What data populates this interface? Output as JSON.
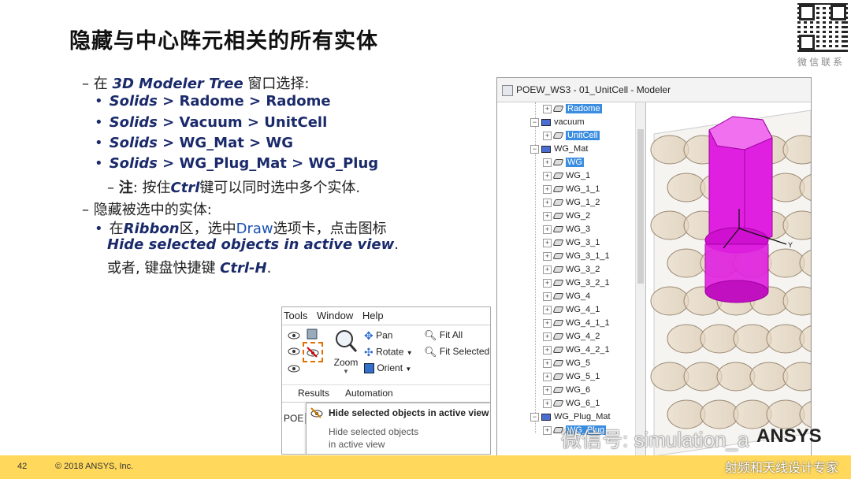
{
  "slide": {
    "title": "隐藏与中心阵元相关的所有实体",
    "page_number": "42",
    "copyright": "© 2018 ANSYS, Inc.",
    "qr_caption": "微信联系",
    "watermark": "微信号: simulation_a",
    "watermark_sub": "射频和天线设计专家",
    "logo_text": "ANSYS",
    "accent_color": "#ffd85c"
  },
  "bullets": {
    "b1_prefix": "– 在 ",
    "b1_em": "3D Modeler Tree",
    "b1_suffix": " 窗口选择:",
    "items": [
      {
        "em": "Solids",
        "rest": " > Radome > Radome"
      },
      {
        "em": "Solids",
        "rest": " > Vacuum > UnitCell"
      },
      {
        "em": "Solids",
        "rest": " > WG_Mat > WG"
      },
      {
        "em": "Solids",
        "rest": " > WG_Plug_Mat > WG_Plug"
      }
    ],
    "note_prefix": "– ",
    "note_label": "注",
    "note_mid": ": 按住",
    "note_key": "Ctrl",
    "note_suffix": "键可以同时选中多个实体.",
    "b2": "– 隐藏被选中的实体:",
    "b2a_prefix": "在",
    "b2a_em": "Ribbon",
    "b2a_mid": "区，选中",
    "b2a_tab": "Draw",
    "b2a_suffix": "选项卡，点击图标",
    "b2a_cmd": "Hide selected objects in active view",
    "b2a_dot": ".",
    "b2b_prefix": "或者, 键盘快捷键 ",
    "b2b_key": "Ctrl-H",
    "b2b_dot": "."
  },
  "modeler": {
    "title": "POEW_WS3 - 01_UnitCell - Modeler",
    "tree": [
      {
        "label": "Radome",
        "kind": "obj",
        "indent": 2,
        "selected": true
      },
      {
        "label": "vacuum",
        "kind": "folder",
        "indent": 1,
        "selected": false
      },
      {
        "label": "UnitCell",
        "kind": "obj",
        "indent": 2,
        "selected": true
      },
      {
        "label": "WG_Mat",
        "kind": "folder",
        "indent": 1,
        "selected": false
      },
      {
        "label": "WG",
        "kind": "obj",
        "indent": 2,
        "selected": true
      },
      {
        "label": "WG_1",
        "kind": "obj",
        "indent": 2,
        "selected": false
      },
      {
        "label": "WG_1_1",
        "kind": "obj",
        "indent": 2,
        "selected": false
      },
      {
        "label": "WG_1_2",
        "kind": "obj",
        "indent": 2,
        "selected": false
      },
      {
        "label": "WG_2",
        "kind": "obj",
        "indent": 2,
        "selected": false
      },
      {
        "label": "WG_3",
        "kind": "obj",
        "indent": 2,
        "selected": false
      },
      {
        "label": "WG_3_1",
        "kind": "obj",
        "indent": 2,
        "selected": false
      },
      {
        "label": "WG_3_1_1",
        "kind": "obj",
        "indent": 2,
        "selected": false
      },
      {
        "label": "WG_3_2",
        "kind": "obj",
        "indent": 2,
        "selected": false
      },
      {
        "label": "WG_3_2_1",
        "kind": "obj",
        "indent": 2,
        "selected": false
      },
      {
        "label": "WG_4",
        "kind": "obj",
        "indent": 2,
        "selected": false
      },
      {
        "label": "WG_4_1",
        "kind": "obj",
        "indent": 2,
        "selected": false
      },
      {
        "label": "WG_4_1_1",
        "kind": "obj",
        "indent": 2,
        "selected": false
      },
      {
        "label": "WG_4_2",
        "kind": "obj",
        "indent": 2,
        "selected": false
      },
      {
        "label": "WG_4_2_1",
        "kind": "obj",
        "indent": 2,
        "selected": false
      },
      {
        "label": "WG_5",
        "kind": "obj",
        "indent": 2,
        "selected": false
      },
      {
        "label": "WG_5_1",
        "kind": "obj",
        "indent": 2,
        "selected": false
      },
      {
        "label": "WG_6",
        "kind": "obj",
        "indent": 2,
        "selected": false
      },
      {
        "label": "WG_6_1",
        "kind": "obj",
        "indent": 2,
        "selected": false
      },
      {
        "label": "WG_Plug_Mat",
        "kind": "folder",
        "indent": 1,
        "selected": false
      },
      {
        "label": "WG_Plug",
        "kind": "obj",
        "indent": 2,
        "selected": true
      }
    ],
    "axis_label_y": "Y",
    "object_color": "#e020e0"
  },
  "ribbon": {
    "menu": [
      "Tools",
      "Window",
      "Help"
    ],
    "zoom_label": "Zoom",
    "pan_label": "Pan",
    "rotate_label": "Rotate",
    "orient_label": "Orient",
    "fit_all_label": "Fit All",
    "fit_selected_label": "Fit Selected",
    "group_results": "Results",
    "group_automation": "Automation",
    "side_tab": "POE",
    "tooltip_title": "Hide selected objects in active view",
    "tooltip_line1": "Hide selected objects",
    "tooltip_line2": "in active view"
  }
}
